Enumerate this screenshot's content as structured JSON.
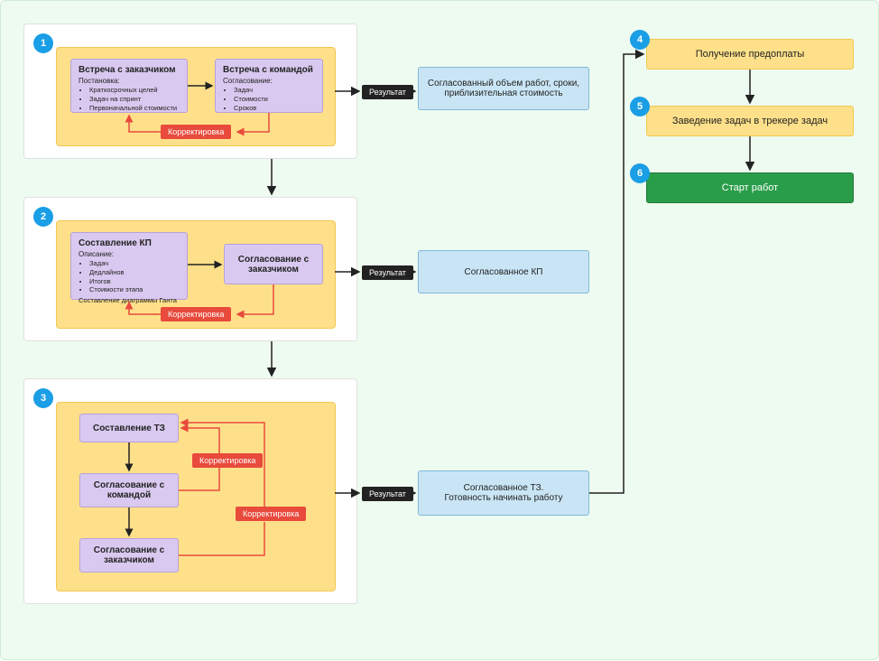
{
  "stage1": {
    "badge": "1",
    "box1": {
      "title": "Встреча с заказчиком",
      "subtitle": "Постановка:",
      "items": [
        "Краткосрочных целей",
        "Задач на спринт",
        "Первоначальной стоимости"
      ]
    },
    "box2": {
      "title": "Встреча с командой",
      "subtitle": "Согласование:",
      "items": [
        "Задач",
        "Стоимости",
        "Сроков"
      ]
    },
    "correction": "Корректировка",
    "resultLabel": "Результат",
    "result": "Согласованный объем работ, сроки, приблизительная стоимость"
  },
  "stage2": {
    "badge": "2",
    "box1": {
      "title": "Составление КП",
      "subtitle": "Описание:",
      "items": [
        "Задач",
        "Дедлайнов",
        "Итогов",
        "Стоимости этапа"
      ],
      "footer": "Составление диаграммы Ганта"
    },
    "box2": {
      "title": "Согласование с заказчиком"
    },
    "correction": "Корректировка",
    "resultLabel": "Результат",
    "result": "Согласованное КП"
  },
  "stage3": {
    "badge": "3",
    "box1": {
      "title": "Составление ТЗ"
    },
    "box2": {
      "title": "Согласование с командой"
    },
    "box3": {
      "title": "Согласование с заказчиком"
    },
    "correction1": "Корректировка",
    "correction2": "Корректировка",
    "resultLabel": "Результат",
    "result": "Согласованное ТЗ.\nГотовность начинать работу"
  },
  "step4": {
    "badge": "4",
    "label": "Получение предоплаты"
  },
  "step5": {
    "badge": "5",
    "label": "Заведение задач в трекере задач"
  },
  "step6": {
    "badge": "6",
    "label": "Старт работ"
  }
}
